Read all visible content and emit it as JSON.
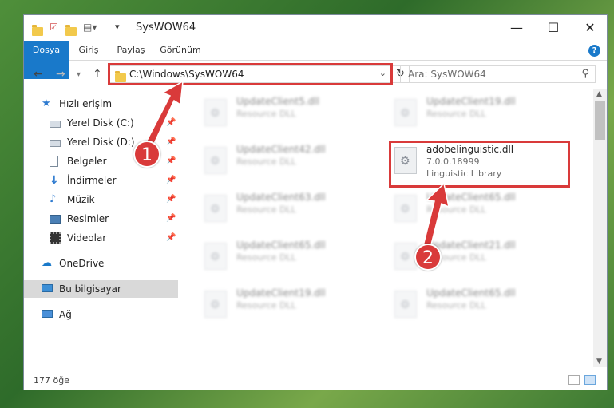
{
  "window": {
    "title": "SysWOW64",
    "controls": {
      "minimize": "—",
      "maximize": "☐",
      "close": "✕"
    }
  },
  "ribbon": {
    "tabs": [
      "Dosya",
      "Giriş",
      "Paylaş",
      "Görünüm"
    ],
    "help": "?"
  },
  "address": {
    "path": "C:\\Windows\\SysWOW64",
    "search_placeholder": "Ara: SysWOW64"
  },
  "sidebar": {
    "quick_access": "Hızlı erişim",
    "items": [
      {
        "label": "Yerel Disk (C:)",
        "icon": "drive-icon"
      },
      {
        "label": "Yerel Disk (D:)",
        "icon": "drive-icon"
      },
      {
        "label": "Belgeler",
        "icon": "documents-icon"
      },
      {
        "label": "İndirmeler",
        "icon": "downloads-icon"
      },
      {
        "label": "Müzik",
        "icon": "music-icon"
      },
      {
        "label": "Resimler",
        "icon": "pictures-icon"
      },
      {
        "label": "Videolar",
        "icon": "videos-icon"
      }
    ],
    "onedrive": "OneDrive",
    "this_pc": "Bu bilgisayar",
    "network": "Ağ"
  },
  "files": {
    "left": [
      {
        "name": "UpdateClient5.dll",
        "type": "Resource DLL"
      },
      {
        "name": "UpdateClient42.dll",
        "type": "Resource DLL"
      },
      {
        "name": "UpdateClient63.dll",
        "type": "Resource DLL"
      },
      {
        "name": "UpdateClient65.dll",
        "type": "Resource DLL"
      },
      {
        "name": "UpdateClient19.dll",
        "type": "Resource DLL"
      }
    ],
    "right": [
      {
        "name": "UpdateClient19.dll",
        "type": "Resource DLL"
      },
      {
        "name": "UpdateClient65.dll",
        "type": "Resource DLL"
      },
      {
        "name": "UpdateClient21.dll",
        "type": "Resource DLL"
      },
      {
        "name": "UpdateClient65.dll",
        "type": "Resource DLL"
      }
    ],
    "highlighted": {
      "name": "adobelinguistic.dll",
      "version": "7.0.0.18999",
      "description": "Linguistic Library"
    }
  },
  "status": {
    "count": "177 öğe"
  },
  "annotations": {
    "step1": "1",
    "step2": "2",
    "color": "#d93a3a"
  }
}
